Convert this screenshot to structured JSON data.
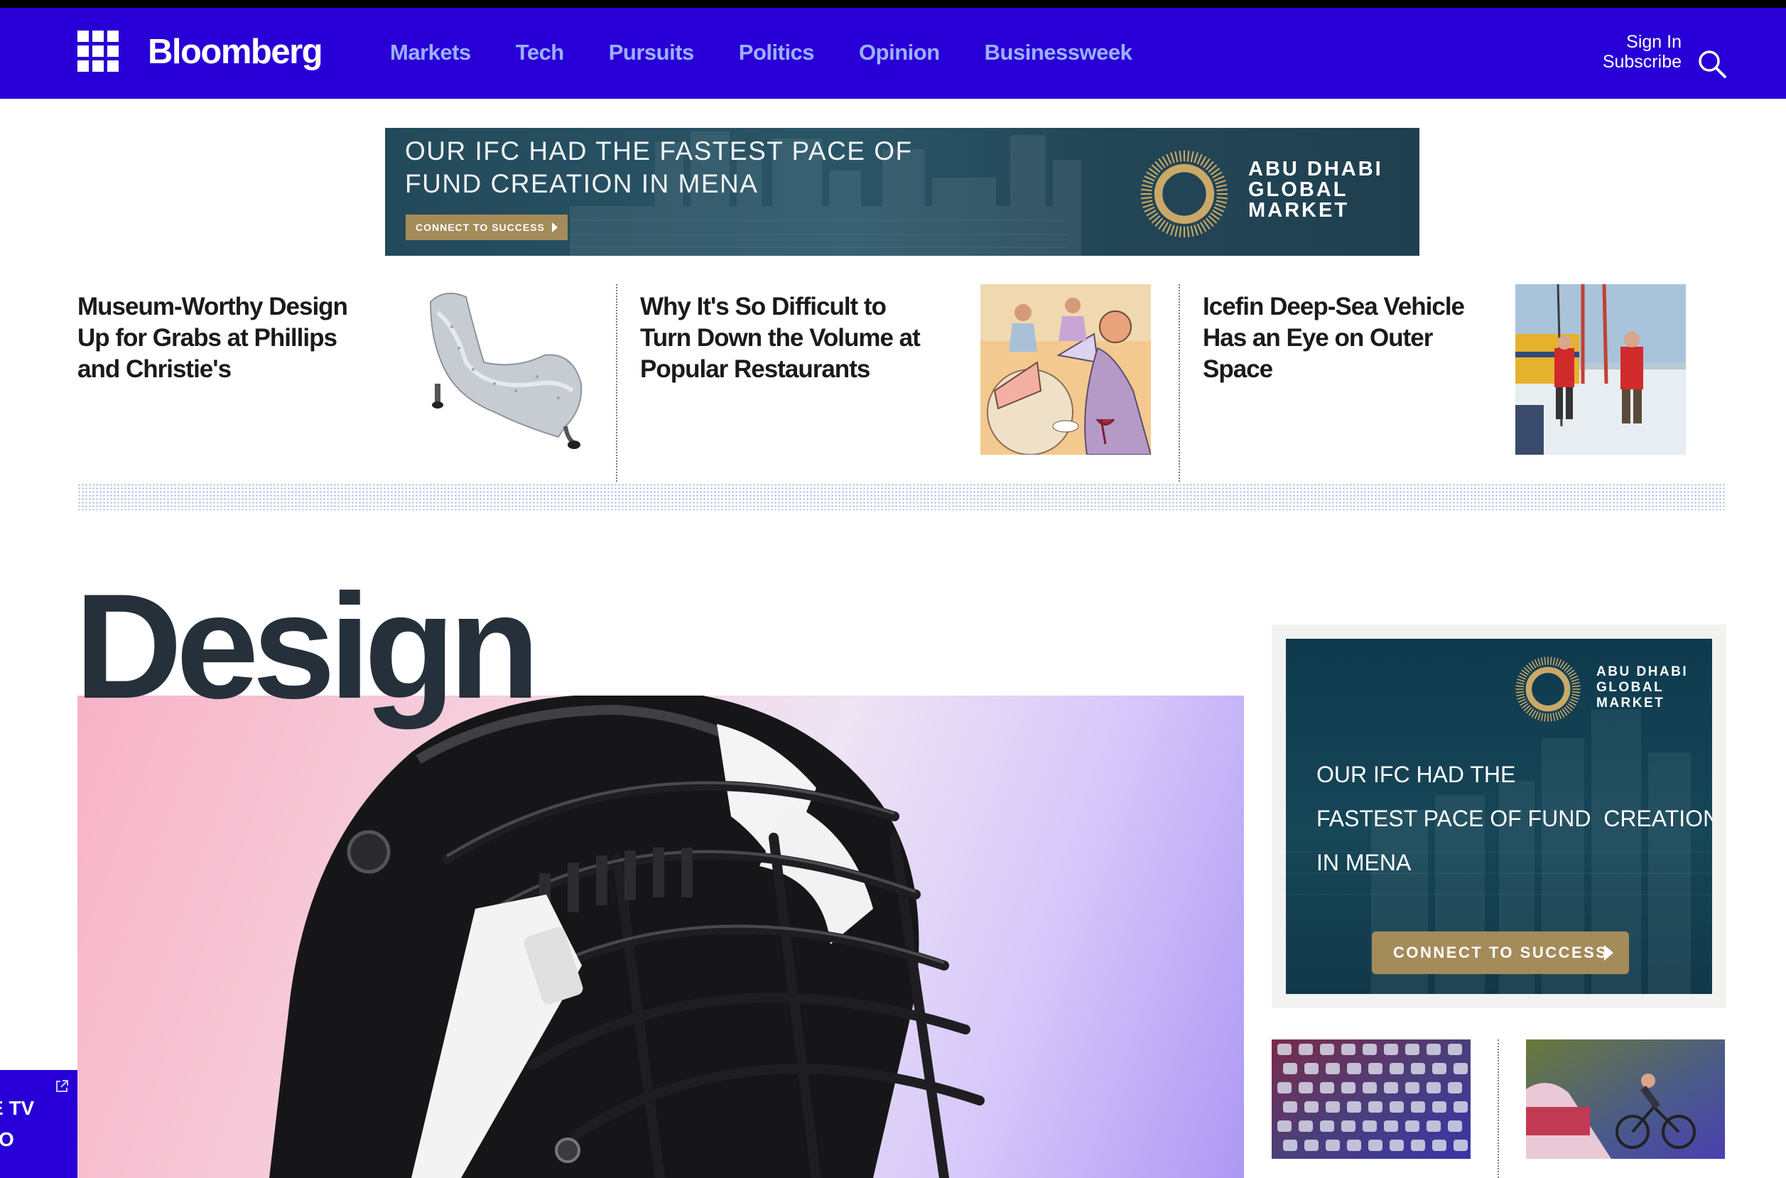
{
  "header": {
    "brand": "Bloomberg",
    "nav": [
      "Markets",
      "Tech",
      "Pursuits",
      "Politics",
      "Opinion",
      "Businessweek"
    ],
    "sign_in": "Sign In",
    "subscribe": "Subscribe"
  },
  "top_ad": {
    "headline_line1": "OUR IFC HAD THE FASTEST PACE OF",
    "headline_line2": "FUND CREATION IN MENA",
    "cta": "CONNECT TO SUCCESS",
    "brand_line1": "ABU DHABI",
    "brand_line2": "GLOBAL",
    "brand_line3": "MARKET"
  },
  "stories": [
    {
      "title": "Museum-Worthy Design Up for Grabs at Phillips and Christie's",
      "image": "silver-chaise-lounge"
    },
    {
      "title": "Why It's So Difficult to Turn Down the Volume at Popular Restaurants",
      "image": "noisy-restaurant-illustration"
    },
    {
      "title": "Icefin Deep-Sea Vehicle Has an Eye on Outer Space",
      "image": "researchers-on-ice"
    }
  ],
  "section": {
    "title": "Design",
    "hero_image": "football-helmet"
  },
  "side_ad": {
    "brand_line1": "ABU DHABI",
    "brand_line2": "GLOBAL",
    "brand_line3": "MARKET",
    "text_line1": "OUR IFC HAD THE",
    "text_line2": "FASTEST PACE OF FUND  CREATION",
    "text_line3": "IN MENA",
    "cta": "CONNECT TO SUCCESS"
  },
  "mini_images": [
    "traffic-jam",
    "cyclists-and-car"
  ],
  "live_tab": {
    "line1": "E TV",
    "line2": "DIO"
  },
  "colors": {
    "nav_bg": "#2800d7",
    "nav_link": "#9db0ff",
    "ad_gold": "#a48b5a",
    "ad_teal": "#164657"
  }
}
